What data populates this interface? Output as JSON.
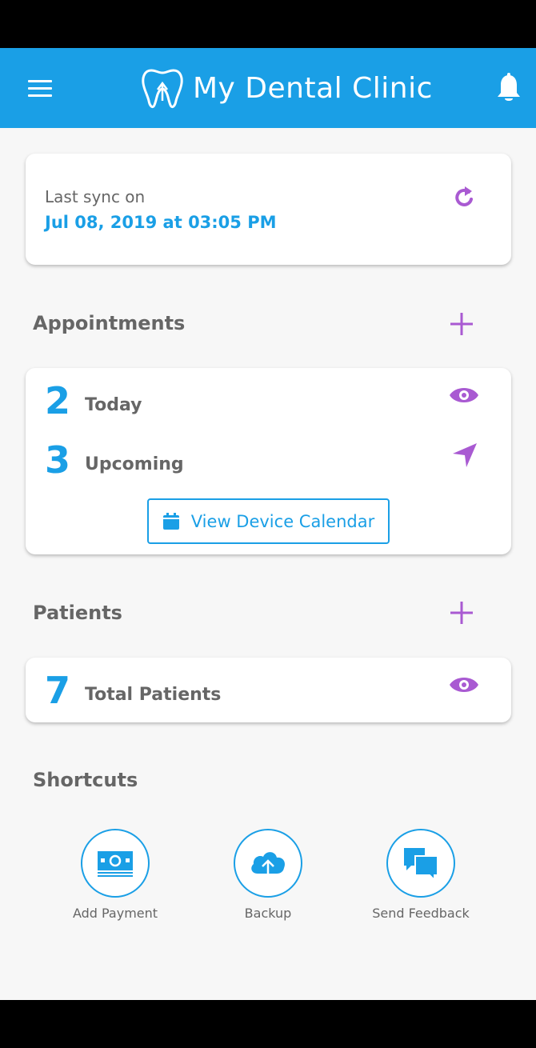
{
  "app": {
    "title": "My Dental Clinic"
  },
  "sync": {
    "label": "Last sync on",
    "time": "Jul 08, 2019 at 03:05 PM"
  },
  "appointments": {
    "title": "Appointments",
    "today_count": "2",
    "today_label": "Today",
    "upcoming_count": "3",
    "upcoming_label": "Upcoming",
    "calendar_button": "View Device Calendar"
  },
  "patients": {
    "title": "Patients",
    "total_count": "7",
    "total_label": "Total Patients"
  },
  "shortcuts": {
    "title": "Shortcuts",
    "items": [
      {
        "label": "Add Payment",
        "icon": "payment-icon"
      },
      {
        "label": "Backup",
        "icon": "cloud-upload-icon"
      },
      {
        "label": "Send Feedback",
        "icon": "chat-icon"
      }
    ]
  },
  "colors": {
    "primary": "#1a9fe6",
    "accent": "#a95ad2",
    "text": "#666666"
  }
}
